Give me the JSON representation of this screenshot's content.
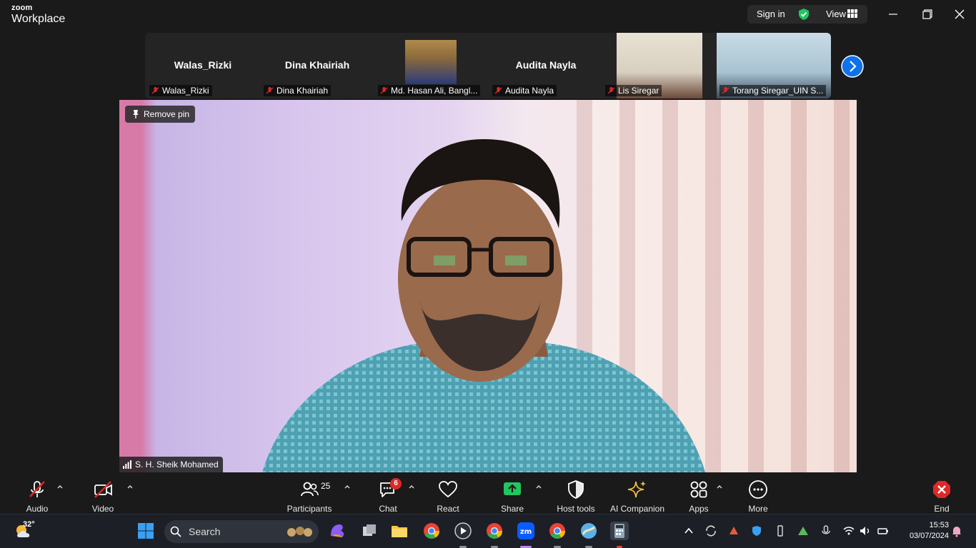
{
  "app": {
    "brand_line1": "zoom",
    "brand_line2": "Workplace"
  },
  "header": {
    "signin_label": "Sign in",
    "view_label": "View"
  },
  "gallery": {
    "tiles": [
      {
        "big_name": "Walas_Rizki",
        "caption": "Walas_Rizki"
      },
      {
        "big_name": "Dina Khairiah",
        "caption": "Dina Khairiah"
      },
      {
        "big_name": "",
        "caption": "Md. Hasan Ali, Bangl..."
      },
      {
        "big_name": "Audita Nayla",
        "caption": "Audita Nayla"
      },
      {
        "big_name": "",
        "caption": "Lis Siregar"
      },
      {
        "big_name": "",
        "caption": "Torang Siregar_UIN S..."
      }
    ]
  },
  "main_video": {
    "pin_label": "Remove pin",
    "speaker_name": "S. H. Sheik Mohamed"
  },
  "toolbar": {
    "audio": "Audio",
    "video": "Video",
    "participants": "Participants",
    "participants_count": "25",
    "chat": "Chat",
    "chat_badge": "6",
    "react": "React",
    "share": "Share",
    "host_tools": "Host tools",
    "ai_companion": "AI Companion",
    "apps": "Apps",
    "more": "More",
    "end": "End"
  },
  "taskbar": {
    "temperature": "32°",
    "search_label": "Search",
    "time": "15:53",
    "date": "03/07/2024"
  },
  "colors": {
    "accent": "#0e72ed",
    "share_green": "#22c55e",
    "end_red": "#e02828",
    "mute_red": "#e02828"
  }
}
